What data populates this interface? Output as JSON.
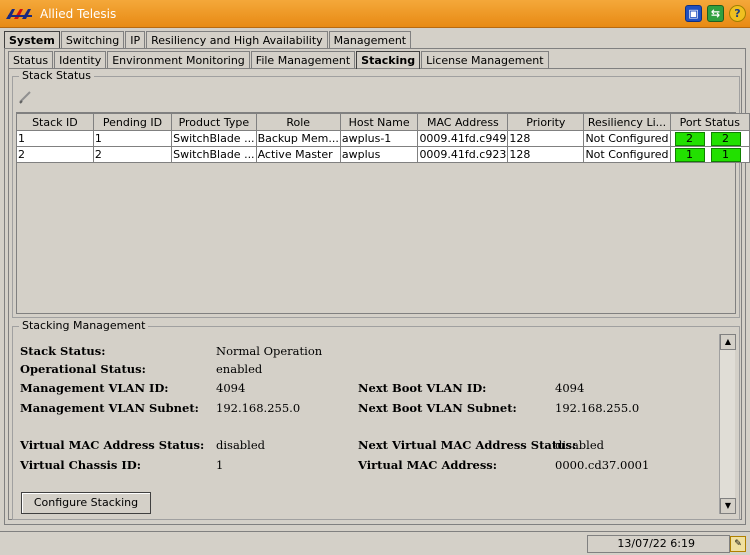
{
  "app": {
    "title": "Allied Telesis"
  },
  "top_tabs": [
    {
      "label": "System",
      "active": true
    },
    {
      "label": "Switching",
      "active": false
    },
    {
      "label": "IP",
      "active": false
    },
    {
      "label": "Resiliency and High Availability",
      "active": false
    },
    {
      "label": "Management",
      "active": false
    }
  ],
  "sub_tabs": [
    {
      "label": "Status",
      "active": false
    },
    {
      "label": "Identity",
      "active": false
    },
    {
      "label": "Environment Monitoring",
      "active": false
    },
    {
      "label": "File Management",
      "active": false
    },
    {
      "label": "Stacking",
      "active": true
    },
    {
      "label": "License Management",
      "active": false
    }
  ],
  "stack_status": {
    "group_label": "Stack Status",
    "columns": [
      "Stack ID",
      "Pending ID",
      "Product Type",
      "Role",
      "Host Name",
      "MAC Address",
      "Priority",
      "Resiliency Li...",
      "Port Status"
    ],
    "rows": [
      {
        "stack_id": "1",
        "pending_id": "1",
        "product_type": "SwitchBlade ...",
        "role": "Backup Mem...",
        "host_name": "awplus-1",
        "mac": "0009.41fd.c949",
        "priority": "128",
        "resiliency": "Not Configured",
        "port1": "2",
        "port2": "2"
      },
      {
        "stack_id": "2",
        "pending_id": "2",
        "product_type": "SwitchBlade ...",
        "role": "Active Master",
        "host_name": "awplus",
        "mac": "0009.41fd.c923",
        "priority": "128",
        "resiliency": "Not Configured",
        "port1": "1",
        "port2": "1"
      }
    ]
  },
  "stacking_management": {
    "group_label": "Stacking Management",
    "stack_status_label": "Stack Status:",
    "stack_status_value": "Normal Operation",
    "operational_status_label": "Operational Status:",
    "operational_status_value": "enabled",
    "mgmt_vlan_id_label": "Management VLAN ID:",
    "mgmt_vlan_id_value": "4094",
    "next_boot_vlan_id_label": "Next Boot VLAN ID:",
    "next_boot_vlan_id_value": "4094",
    "mgmt_vlan_subnet_label": "Management VLAN Subnet:",
    "mgmt_vlan_subnet_value": "192.168.255.0",
    "next_boot_vlan_subnet_label": "Next Boot VLAN Subnet:",
    "next_boot_vlan_subnet_value": "192.168.255.0",
    "vmac_status_label": "Virtual MAC Address Status:",
    "vmac_status_value": "disabled",
    "next_vmac_status_label": "Next Virtual MAC Address Status:",
    "next_vmac_status_value": "disabled",
    "chassis_id_label": "Virtual Chassis ID:",
    "chassis_id_value": "1",
    "vmac_label": "Virtual MAC Address:",
    "vmac_value": "0000.cd37.0001",
    "configure_button": "Configure Stacking"
  },
  "statusbar": {
    "datetime": "13/07/22 6:19"
  },
  "colors": {
    "titlebar": "#e88a14",
    "port_ok": "#22e000"
  }
}
